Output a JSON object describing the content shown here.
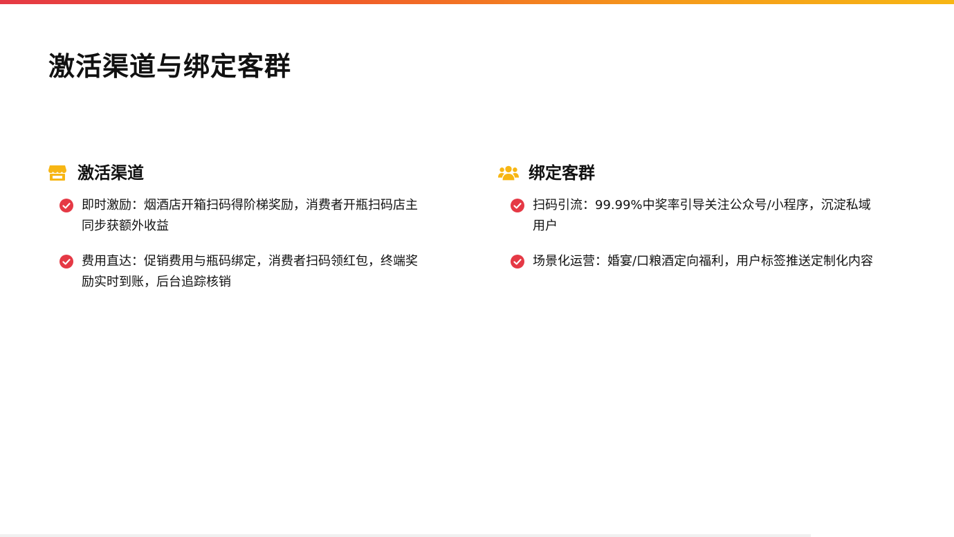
{
  "page": {
    "title": "激活渠道与绑定客群"
  },
  "sections": [
    {
      "title": "激活渠道",
      "icon": "store-icon",
      "items": [
        {
          "text": "即时激励：烟酒店开箱扫码得阶梯奖励，消费者开瓶扫码店主同步获额外收益"
        },
        {
          "text": "费用直达：促销费用与瓶码绑定，消费者扫码领红包，终端奖励实时到账，后台追踪核销"
        }
      ]
    },
    {
      "title": "绑定客群",
      "icon": "users-icon",
      "items": [
        {
          "text": "扫码引流：99.99%中奖率引导关注公众号/小程序，沉淀私域用户"
        },
        {
          "text": "场景化运营：婚宴/口粮酒定向福利，用户标签推送定制化内容"
        }
      ]
    }
  ],
  "colors": {
    "accent_red": "#e53945",
    "accent_orange": "#f59a1a",
    "icon_yellow": "#f7b614",
    "check_red": "#e53945"
  }
}
